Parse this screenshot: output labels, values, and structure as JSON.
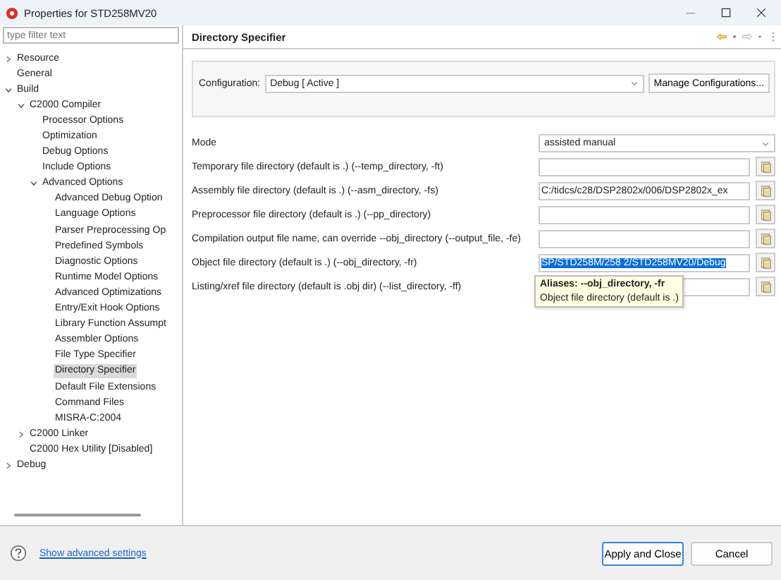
{
  "window": {
    "title": "Properties for STD258MV20"
  },
  "filter": {
    "placeholder": "type filter text"
  },
  "tree": [
    {
      "label": "Resource",
      "expanded": false,
      "selected": false
    },
    {
      "label": "General",
      "selected": false
    },
    {
      "label": "Build",
      "expanded": true,
      "selected": false,
      "children": [
        {
          "label": "C2000 Compiler",
          "expanded": true,
          "selected": false,
          "children": [
            {
              "label": "Processor Options",
              "selected": false
            },
            {
              "label": "Optimization",
              "selected": false
            },
            {
              "label": "Debug Options",
              "selected": false
            },
            {
              "label": "Include Options",
              "selected": false
            },
            {
              "label": "Advanced Options",
              "expanded": true,
              "selected": false,
              "children": [
                {
                  "label": "Advanced Debug Option",
                  "selected": false
                },
                {
                  "label": "Language Options",
                  "selected": false
                },
                {
                  "label": "Parser Preprocessing Op",
                  "selected": false
                },
                {
                  "label": "Predefined Symbols",
                  "selected": false
                },
                {
                  "label": "Diagnostic Options",
                  "selected": false
                },
                {
                  "label": "Runtime Model Options",
                  "selected": false
                },
                {
                  "label": "Advanced Optimizations",
                  "selected": false
                },
                {
                  "label": "Entry/Exit Hook Options",
                  "selected": false
                },
                {
                  "label": "Library Function Assumpt",
                  "selected": false
                },
                {
                  "label": "Assembler Options",
                  "selected": false
                },
                {
                  "label": "File Type Specifier",
                  "selected": false
                },
                {
                  "label": "Directory Specifier",
                  "selected": true
                },
                {
                  "label": "Default File Extensions",
                  "selected": false
                },
                {
                  "label": "Command Files",
                  "selected": false
                },
                {
                  "label": "MISRA-C:2004",
                  "selected": false
                }
              ]
            }
          ]
        },
        {
          "label": "C2000 Linker",
          "expanded": false,
          "selected": false
        },
        {
          "label": "C2000 Hex Utility  [Disabled]",
          "selected": false
        }
      ]
    },
    {
      "label": "Debug",
      "expanded": false,
      "selected": false
    }
  ],
  "page": {
    "title": "Directory Specifier",
    "configuration": {
      "label": "Configuration:",
      "value": "Debug  [ Active ]",
      "button": "Manage Configurations..."
    },
    "mode": {
      "label": "Mode",
      "value": "assisted manual"
    },
    "fields": [
      {
        "label": "Temporary file directory (default is .) (--temp_directory, -ft)"
      },
      {
        "label": "Assembly file directory (default is .) (--asm_directory, -fs)",
        "value": "C:/tidcs/c28/DSP2802x/006/DSP2802x_ex",
        "text_selected": false
      },
      {
        "label": "Preprocessor file directory (default is .) (--pp_directory)"
      },
      {
        "label": "Compilation output file name, can override --obj_directory (--output_file, -fe)"
      },
      {
        "label": "Object file directory (default is .) (--obj_directory, -fr)",
        "value": "SP/STD258M/258 2/STD258MV20/Debug",
        "text_selected": true,
        "tooltip": {
          "title": "Aliases: --obj_directory, -fr",
          "text": "Object file directory (default is .)"
        }
      },
      {
        "label": "Listing/xref file directory (default is .obj dir) (--list_directory, -ff)"
      }
    ]
  },
  "footer": {
    "link": "Show advanced settings",
    "buttons": [
      {
        "label": "Apply and Close",
        "default": true
      },
      {
        "label": "Cancel",
        "default": false
      }
    ]
  }
}
